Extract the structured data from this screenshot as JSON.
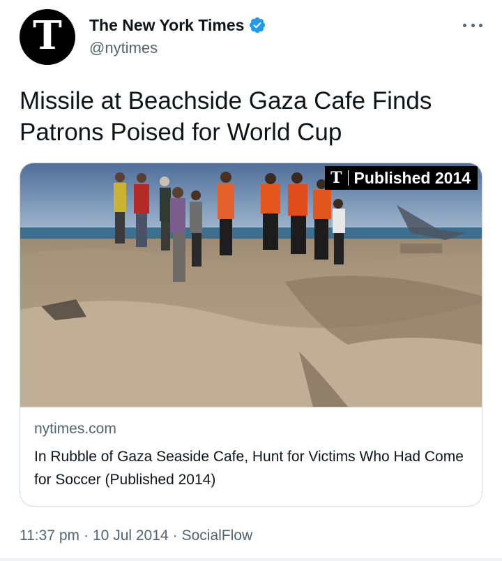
{
  "author": {
    "display_name": "The New York Times",
    "handle": "@nytimes",
    "avatar_glyph": "T",
    "verified": true,
    "verified_icon": "verified-badge-icon",
    "verified_color": "#1d9bf0"
  },
  "menu": {
    "icon": "more-options-icon"
  },
  "tweet": {
    "text": "Missile at Beachside Gaza Cafe Finds Patrons Poised for World Cup"
  },
  "card": {
    "image_icon": "news-photo-beach-rubble",
    "badge_logo": "T",
    "badge_text": "Published 2014",
    "domain": "nytimes.com",
    "title": "In Rubble of Gaza Seaside Cafe, Hunt for Victims Who Had Come for Soccer (Published 2014)"
  },
  "footer": {
    "time": "11:37 pm",
    "date": "10 Jul 2014",
    "source": "SocialFlow",
    "separator": "·"
  },
  "colors": {
    "text_primary": "#0f1419",
    "text_secondary": "#536471",
    "border": "#cfd9de"
  }
}
